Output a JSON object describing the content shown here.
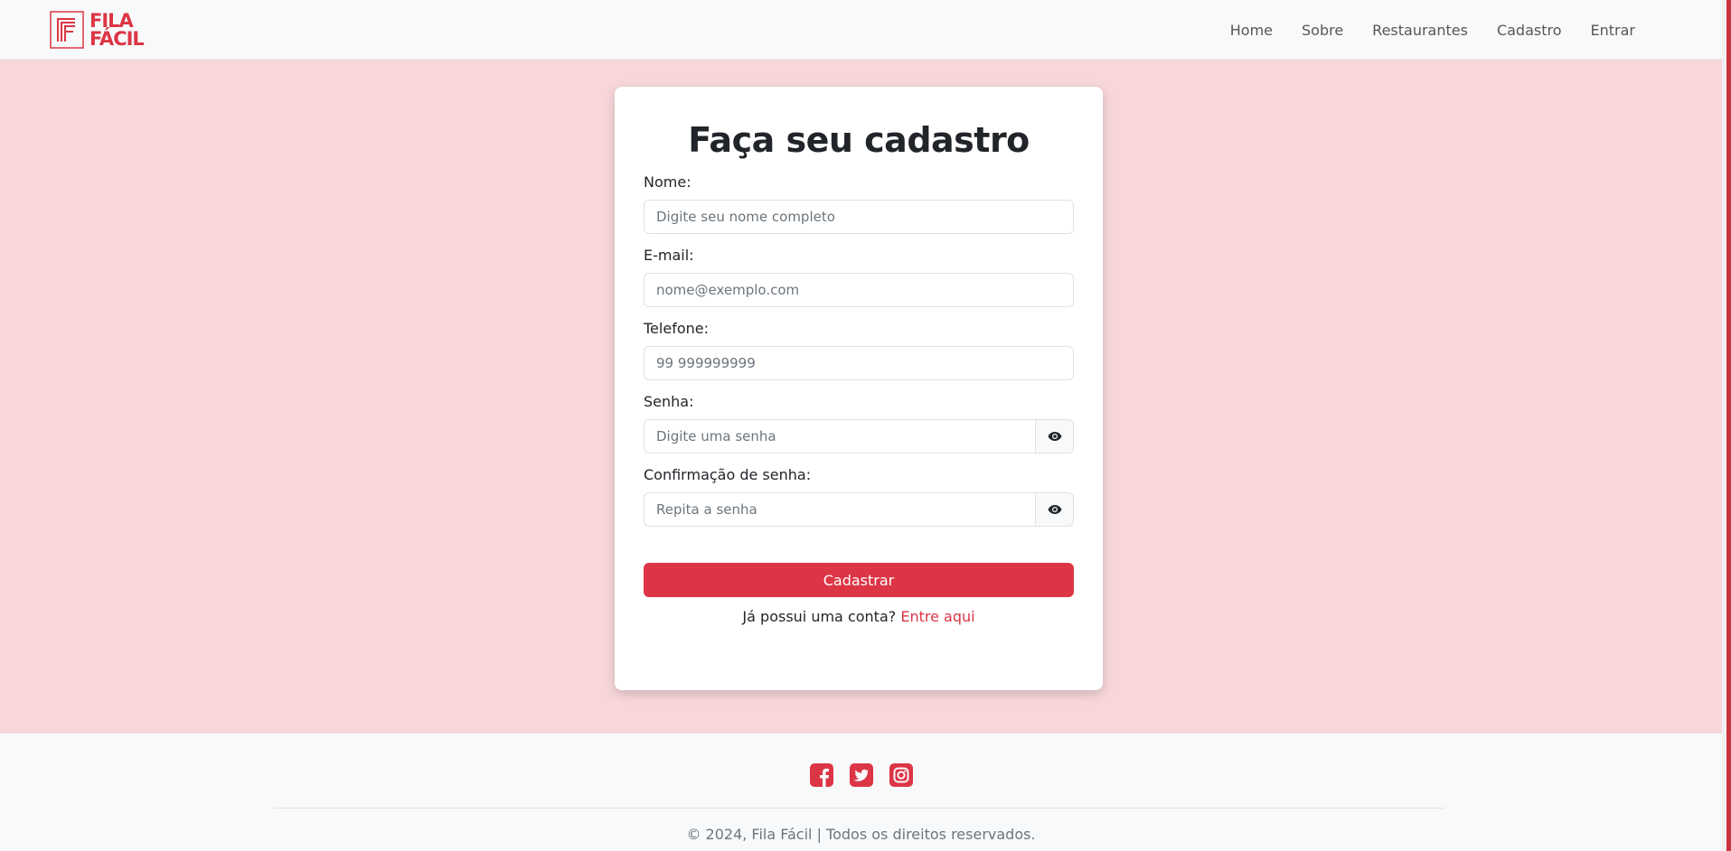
{
  "brand": {
    "line1": "FILA",
    "line2": "FÁCIL",
    "color": "#dc3545"
  },
  "nav": {
    "items": [
      {
        "label": "Home"
      },
      {
        "label": "Sobre"
      },
      {
        "label": "Restaurantes"
      },
      {
        "label": "Cadastro"
      },
      {
        "label": "Entrar"
      }
    ]
  },
  "form": {
    "title": "Faça seu cadastro",
    "name": {
      "label": "Nome:",
      "placeholder": "Digite seu nome completo",
      "value": ""
    },
    "email": {
      "label": "E-mail:",
      "placeholder": "nome@exemplo.com",
      "value": ""
    },
    "phone": {
      "label": "Telefone:",
      "placeholder": "99 999999999",
      "value": ""
    },
    "password": {
      "label": "Senha:",
      "placeholder": "Digite uma senha",
      "value": "",
      "toggle_icon": "eye-icon"
    },
    "password_confirm": {
      "label": "Confirmação de senha:",
      "placeholder": "Repita a senha",
      "value": "",
      "toggle_icon": "eye-icon"
    },
    "submit_label": "Cadastrar",
    "login_prompt": "Já possui uma conta?",
    "login_link": "Entre aqui"
  },
  "footer": {
    "social_icons": [
      "facebook-icon",
      "twitter-icon",
      "instagram-icon"
    ],
    "copyright": "© 2024, Fila Fácil | Todos os direitos reservados."
  },
  "colors": {
    "accent": "#dc3545",
    "page_background": "#f8d7da",
    "navbar_background": "#f8f9fa"
  }
}
